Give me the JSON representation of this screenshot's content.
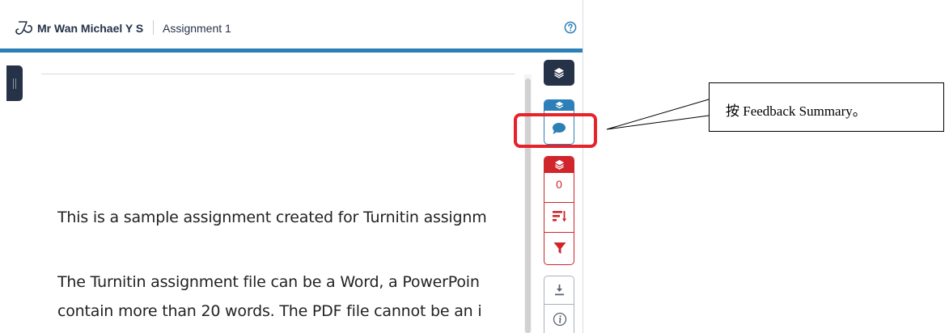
{
  "header": {
    "user_name": "Mr Wan Michael Y S",
    "assignment_title": "Assignment 1",
    "accent_color": "#2d7fb8"
  },
  "icons": {
    "logo": "turnitin-logo-icon",
    "help": "help-circle-icon",
    "drawer": "drawer-toggle-icon",
    "layers": "layers-icon",
    "comment": "comment-bubble-icon",
    "sort": "sort-icon",
    "filter": "filter-icon",
    "download": "download-icon",
    "info": "info-icon"
  },
  "document": {
    "lines": [
      "This is a sample assignment created for Turnitin assignm",
      "The Turnitin assignment file can be a Word, a PowerPoin",
      "contain more than 20 words. The PDF file cannot be an i"
    ]
  },
  "similarity_panel": {
    "match_count": "0",
    "color": "#d0252a"
  },
  "annotation": {
    "callout_text": "按 Feedback Summary。",
    "highlight_color": "#e8222a"
  }
}
